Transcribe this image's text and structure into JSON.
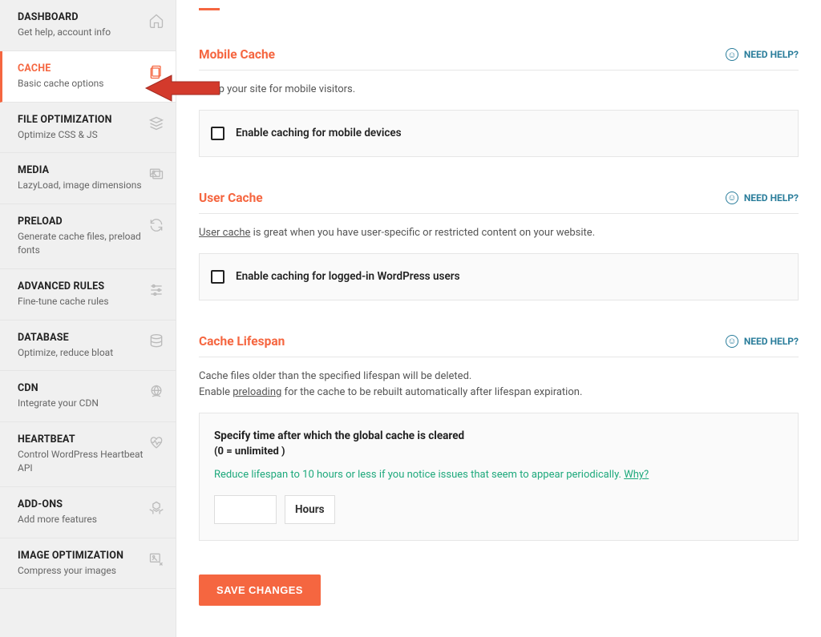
{
  "sidebar": {
    "items": [
      {
        "title": "DASHBOARD",
        "sub": "Get help, account info"
      },
      {
        "title": "CACHE",
        "sub": "Basic cache options"
      },
      {
        "title": "FILE OPTIMIZATION",
        "sub": "Optimize CSS & JS"
      },
      {
        "title": "MEDIA",
        "sub": "LazyLoad, image dimensions"
      },
      {
        "title": "PRELOAD",
        "sub": "Generate cache files, preload fonts"
      },
      {
        "title": "ADVANCED RULES",
        "sub": "Fine-tune cache rules"
      },
      {
        "title": "DATABASE",
        "sub": "Optimize, reduce bloat"
      },
      {
        "title": "CDN",
        "sub": "Integrate your CDN"
      },
      {
        "title": "HEARTBEAT",
        "sub": "Control WordPress Heartbeat API"
      },
      {
        "title": "ADD-ONS",
        "sub": "Add more features"
      },
      {
        "title": "IMAGE OPTIMIZATION",
        "sub": "Compress your images"
      }
    ]
  },
  "help_label": "NEED HELP?",
  "sections": {
    "mobile": {
      "title": "Mobile Cache",
      "desc_suffix": "ed up your site for mobile visitors.",
      "option": "Enable caching for mobile devices"
    },
    "user": {
      "title": "User Cache",
      "desc_link": "User cache",
      "desc_rest": " is great when you have user-specific or restricted content on your website.",
      "option": "Enable caching for logged-in WordPress users"
    },
    "lifespan": {
      "title": "Cache Lifespan",
      "desc1": "Cache files older than the specified lifespan will be deleted.",
      "desc2a": "Enable ",
      "desc2_link": "preloading",
      "desc2b": " for the cache to be rebuilt automatically after lifespan expiration.",
      "box_title": "Specify time after which the global cache is cleared",
      "box_sub": "(0 = unlimited )",
      "hint_text": "Reduce lifespan to 10 hours or less if you notice issues that seem to appear periodically. ",
      "hint_why": "Why?",
      "unit": "Hours",
      "value": ""
    }
  },
  "save_label": "SAVE CHANGES"
}
